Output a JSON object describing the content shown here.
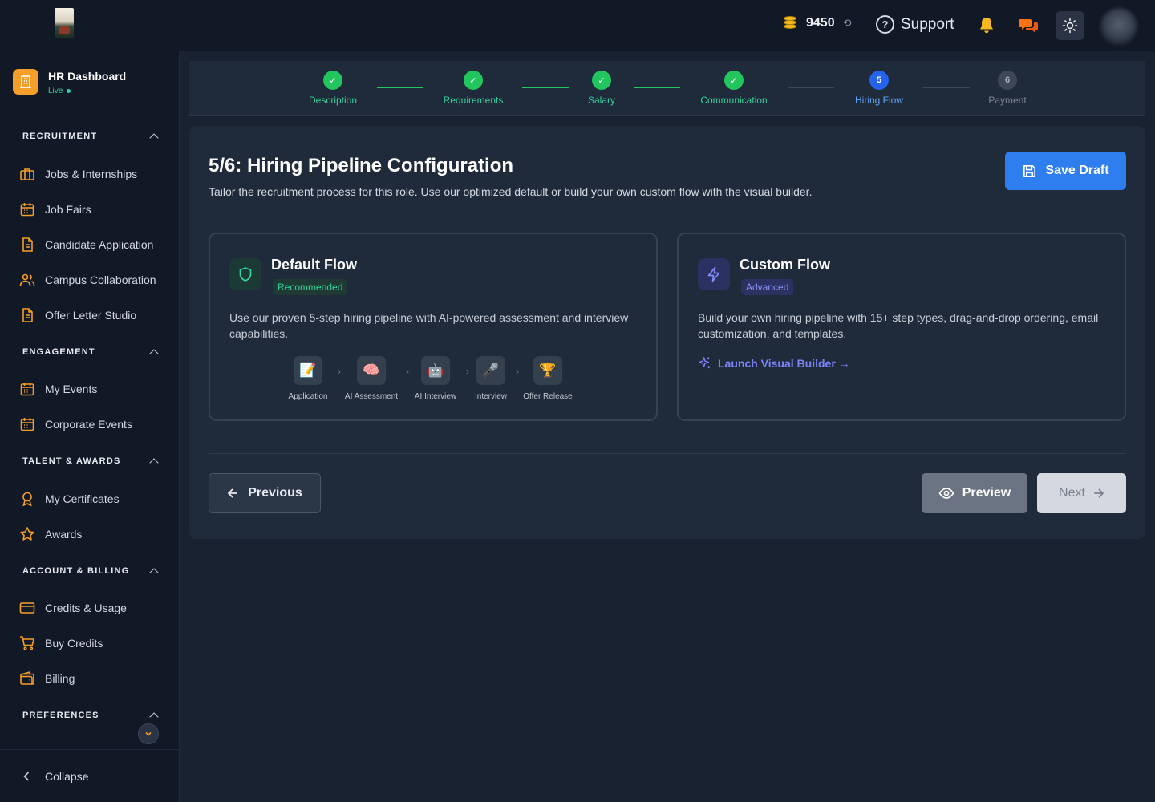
{
  "header": {
    "credits": "9450",
    "support_label": "Support"
  },
  "sidebar": {
    "brand_title": "HR Dashboard",
    "brand_status": "Live",
    "sections": [
      {
        "title": "RECRUITMENT",
        "items": [
          "Jobs & Internships",
          "Job Fairs",
          "Candidate Application",
          "Campus Collaboration",
          "Offer Letter Studio"
        ]
      },
      {
        "title": "ENGAGEMENT",
        "items": [
          "My Events",
          "Corporate Events"
        ]
      },
      {
        "title": "TALENT & AWARDS",
        "items": [
          "My Certificates",
          "Awards"
        ]
      },
      {
        "title": "ACCOUNT & BILLING",
        "items": [
          "Credits & Usage",
          "Buy Credits",
          "Billing"
        ]
      },
      {
        "title": "PREFERENCES",
        "items": []
      }
    ],
    "collapse_label": "Collapse"
  },
  "stepper": {
    "steps": [
      {
        "label": "Description",
        "state": "done",
        "mark": "✓"
      },
      {
        "label": "Requirements",
        "state": "done",
        "mark": "✓"
      },
      {
        "label": "Salary",
        "state": "done",
        "mark": "✓"
      },
      {
        "label": "Communication",
        "state": "done",
        "mark": "✓"
      },
      {
        "label": "Hiring Flow",
        "state": "active",
        "mark": "5"
      },
      {
        "label": "Payment",
        "state": "todo",
        "mark": "6"
      }
    ]
  },
  "main": {
    "title": "5/6: Hiring Pipeline Configuration",
    "subtitle": "Tailor the recruitment process for this role. Use our optimized default or build your own custom flow with the visual builder.",
    "save_label": "Save Draft",
    "default_flow": {
      "title": "Default Flow",
      "badge": "Recommended",
      "description": "Use our proven 5-step hiring pipeline with AI-powered assessment and interview capabilities.",
      "pipeline": [
        {
          "label": "Application",
          "icon": "📝"
        },
        {
          "label": "AI Assessment",
          "icon": "🧠"
        },
        {
          "label": "AI Interview",
          "icon": "🤖"
        },
        {
          "label": "Interview",
          "icon": "🎤"
        },
        {
          "label": "Offer Release",
          "icon": "🏆"
        }
      ]
    },
    "custom_flow": {
      "title": "Custom Flow",
      "badge": "Advanced",
      "description": "Build your own hiring pipeline with 15+ step types, drag-and-drop ordering, email customization, and templates.",
      "launch_label": "Launch Visual Builder →"
    },
    "previous_label": "Previous",
    "preview_label": "Preview",
    "next_label": "Next"
  },
  "colors": {
    "accent_blue": "#2f7ef0",
    "success_green": "#22c55e",
    "brand_orange": "#f59e2a",
    "purple_link": "#7b83f7"
  }
}
